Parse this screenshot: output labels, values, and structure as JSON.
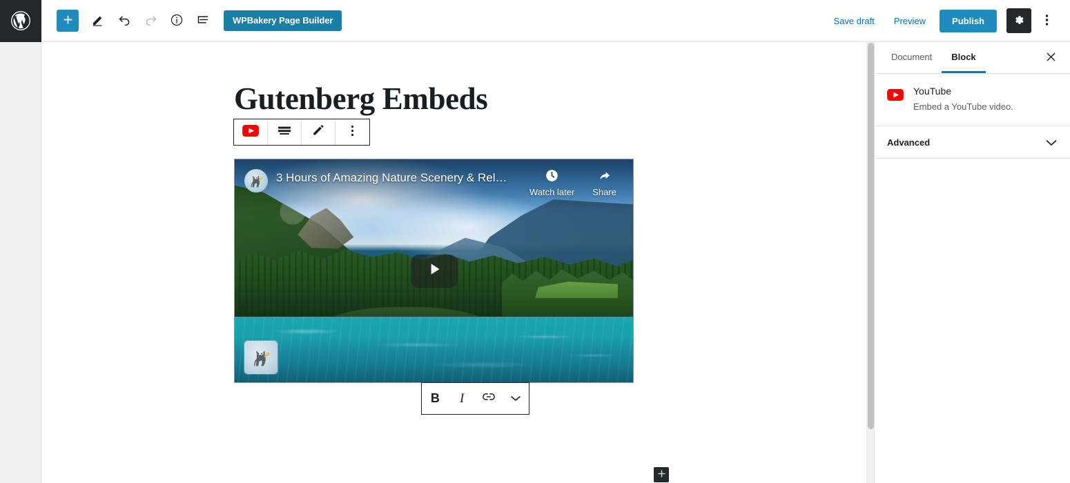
{
  "topbar": {
    "logo_icon": "wordpress-logo-icon",
    "add_block_label": "+",
    "add_block_icon": "plus-icon",
    "edit_icon": "pencil-icon",
    "undo_icon": "undo-arrow-icon",
    "redo_icon": "redo-arrow-icon",
    "info_icon": "info-circle-icon",
    "block_nav_icon": "block-navigation-icon",
    "wpbakery_label": "WPBakery Page Builder",
    "save_draft_label": "Save draft",
    "preview_label": "Preview",
    "publish_label": "Publish",
    "settings_icon": "gear-icon",
    "more_icon": "kebab-menu-icon",
    "accent_blue": "#1e8cbe",
    "link_blue": "#0073aa",
    "dark": "#23282d"
  },
  "editor": {
    "post_title": "Gutenberg Embeds",
    "block_toolbar": {
      "block_type_icon": "youtube-icon",
      "align_icon": "align-wide-icon",
      "edit_icon": "pencil-icon",
      "more_options_icon": "kebab-menu-icon"
    },
    "format_toolbar": {
      "bold_label": "B",
      "italic_label": "I",
      "link_icon": "link-icon",
      "more_icon": "chevron-down-icon"
    },
    "appender": {
      "icon": "plus-icon",
      "label": "+"
    }
  },
  "embed": {
    "provider": "YouTube",
    "video_title": "3 Hours of Amazing Nature Scenery & Rel…",
    "channel_avatar_icon": "cat-trumpet-avatar-icon",
    "watch_later_label": "Watch later",
    "watch_later_icon": "clock-icon",
    "share_label": "Share",
    "share_icon": "share-arrow-icon",
    "play_icon": "play-triangle-icon",
    "watermark_icon": "cat-trumpet-watermark-icon"
  },
  "sidebar": {
    "tabs": [
      {
        "label": "Document",
        "active": false
      },
      {
        "label": "Block",
        "active": true
      }
    ],
    "close_icon": "close-x-icon",
    "block": {
      "icon": "youtube-icon",
      "name": "YouTube",
      "description": "Embed a YouTube video."
    },
    "panels": [
      {
        "label": "Advanced",
        "chevron_icon": "chevron-down-icon"
      }
    ],
    "active_tab_color": "#007cba"
  }
}
